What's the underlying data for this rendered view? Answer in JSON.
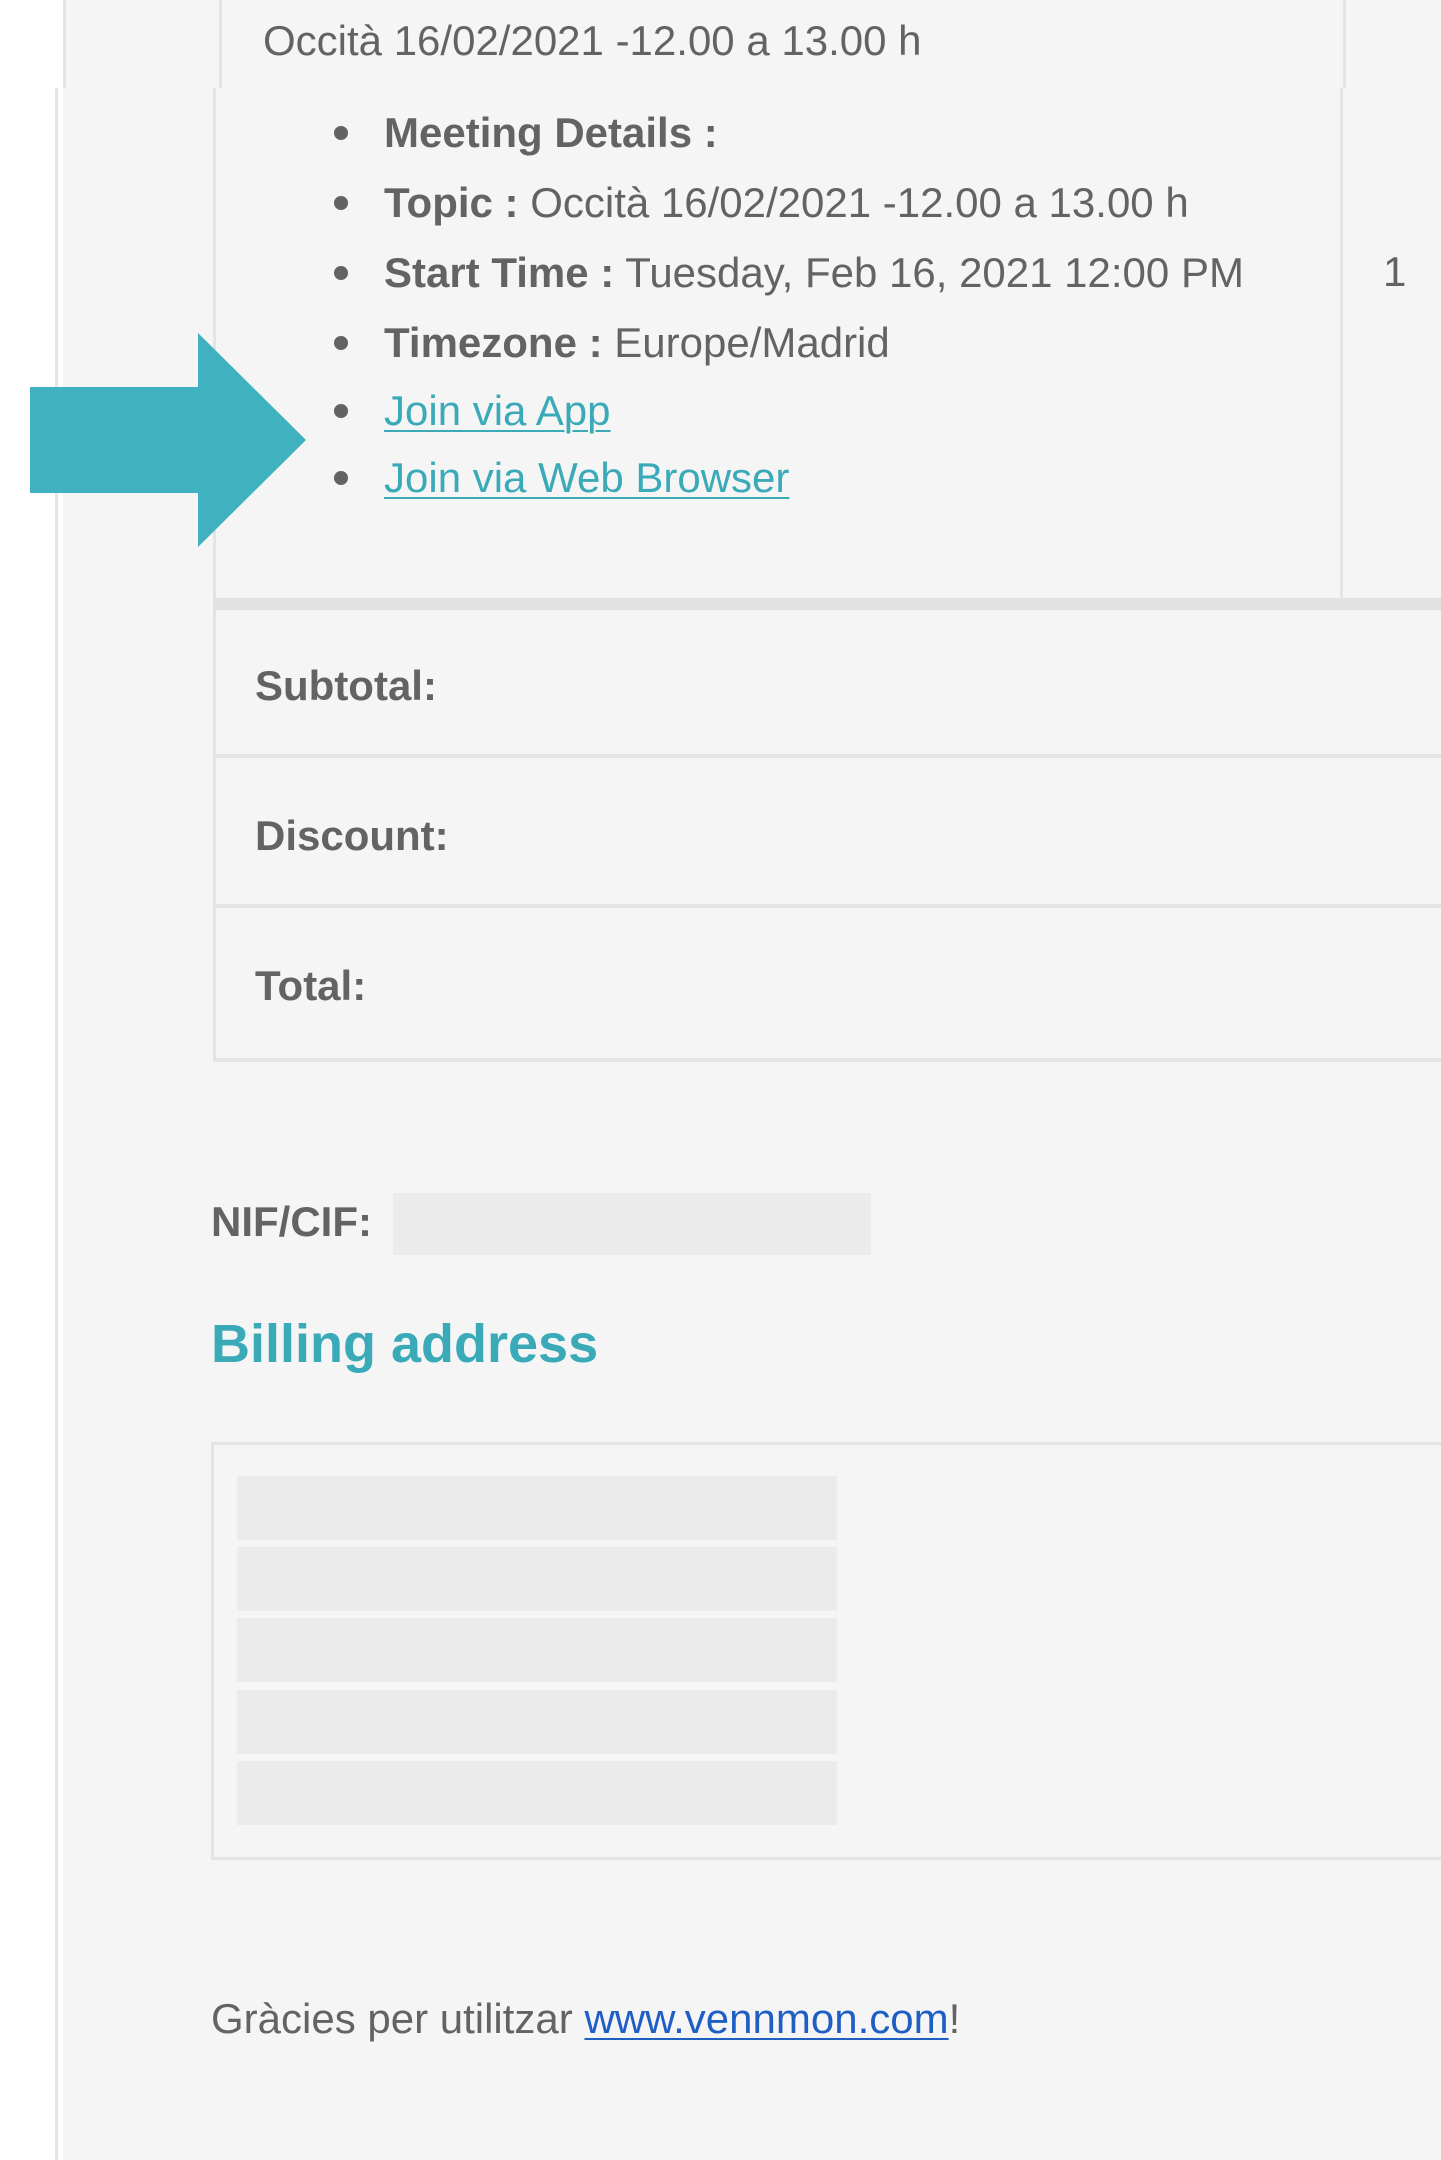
{
  "order_item": {
    "title": "Occità 16/02/2021 -12.00 a 13.00 h",
    "quantity": "1",
    "meeting_details_label": "Meeting Details :",
    "topic_label": "Topic :",
    "topic_value": "Occità 16/02/2021 -12.00 a 13.00 h",
    "start_time_label": "Start Time :",
    "start_time_value": "Tuesday, Feb 16, 2021 12:00 PM",
    "timezone_label": "Timezone :",
    "timezone_value": "Europe/Madrid",
    "join_app_link": "Join via App",
    "join_browser_link": "Join via Web Browser"
  },
  "totals": {
    "subtotal_label": "Subtotal:",
    "discount_label": "Discount:",
    "total_label": "Total:"
  },
  "customer": {
    "nif_label": "NIF/CIF:"
  },
  "billing": {
    "heading": "Billing address"
  },
  "footer": {
    "text_before": "Gràcies per utilitzar ",
    "link": "www.vennmon.com",
    "text_after": "!"
  },
  "colors": {
    "accent_teal": "#3aaab8",
    "link_blue": "#1f5fc4",
    "text_grey": "#636363",
    "background": "#f5f5f5"
  },
  "icons": {
    "pointer": "arrow-right-icon"
  }
}
